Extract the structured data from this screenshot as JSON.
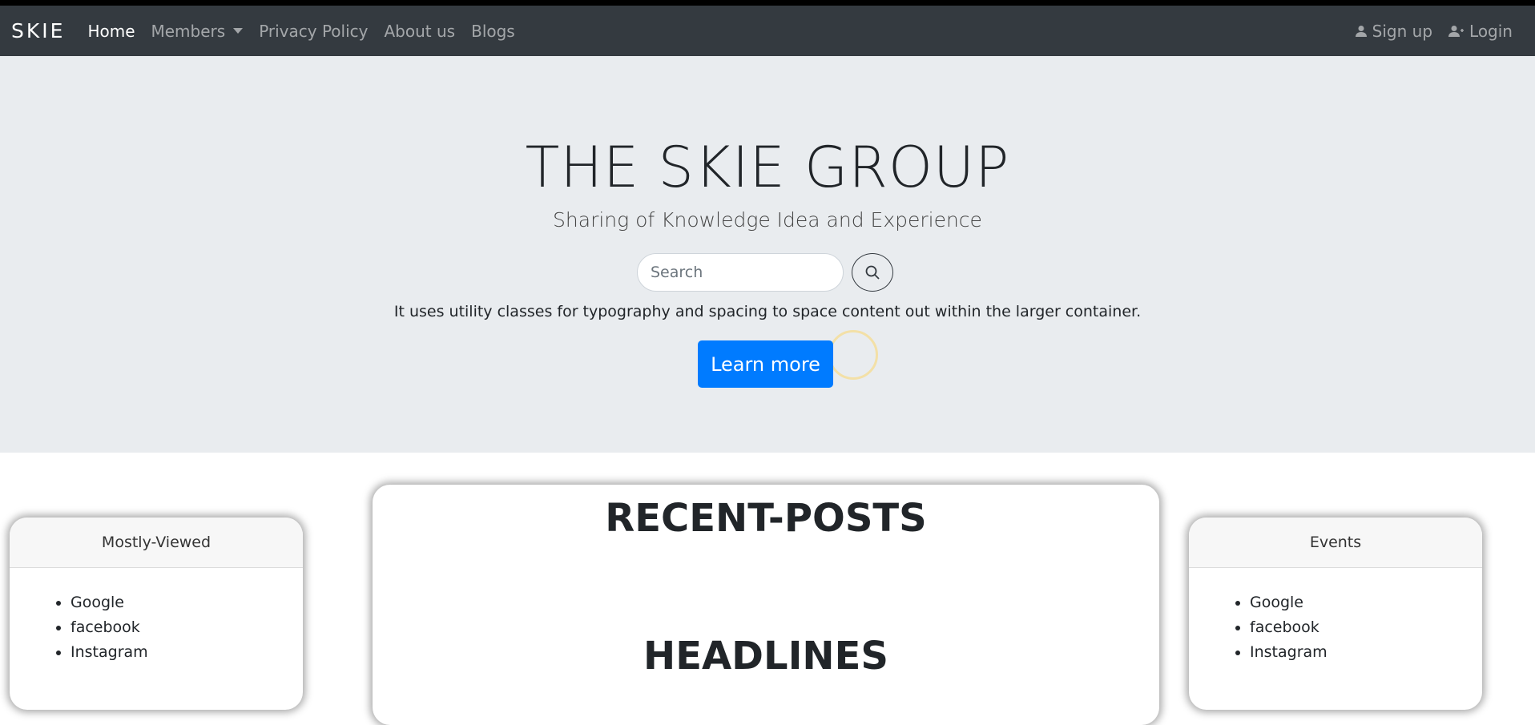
{
  "navbar": {
    "brand": "SKIE",
    "links": [
      {
        "label": "Home"
      },
      {
        "label": "Members"
      },
      {
        "label": "Privacy Policy"
      },
      {
        "label": "About us"
      },
      {
        "label": "Blogs"
      }
    ],
    "signup_label": "Sign up",
    "login_label": "Login",
    "signup_icon": "user-icon",
    "login_icon": "user-plus-icon"
  },
  "hero": {
    "title": "THE SKIE GROUP",
    "subtitle": "Sharing of Knowledge Idea and Experience",
    "search": {
      "placeholder": "Search",
      "value": "",
      "icon": "search-icon"
    },
    "lead": "It uses utility classes for typography and spacing to space content out within the larger container.",
    "button_label": "Learn more"
  },
  "sections": {
    "mostly_viewed": {
      "header": "Mostly-Viewed",
      "items": [
        "Google",
        "facebook",
        "Instagram"
      ]
    },
    "recent_posts": {
      "title": "RECENT-POSTS",
      "headlines": "HEADLINES"
    },
    "events": {
      "header": "Events",
      "items": [
        "Google",
        "facebook",
        "Instagram"
      ]
    }
  },
  "colors": {
    "navbar_bg": "#343a40",
    "jumbotron_bg": "#e9ecef",
    "primary": "#007bff"
  }
}
